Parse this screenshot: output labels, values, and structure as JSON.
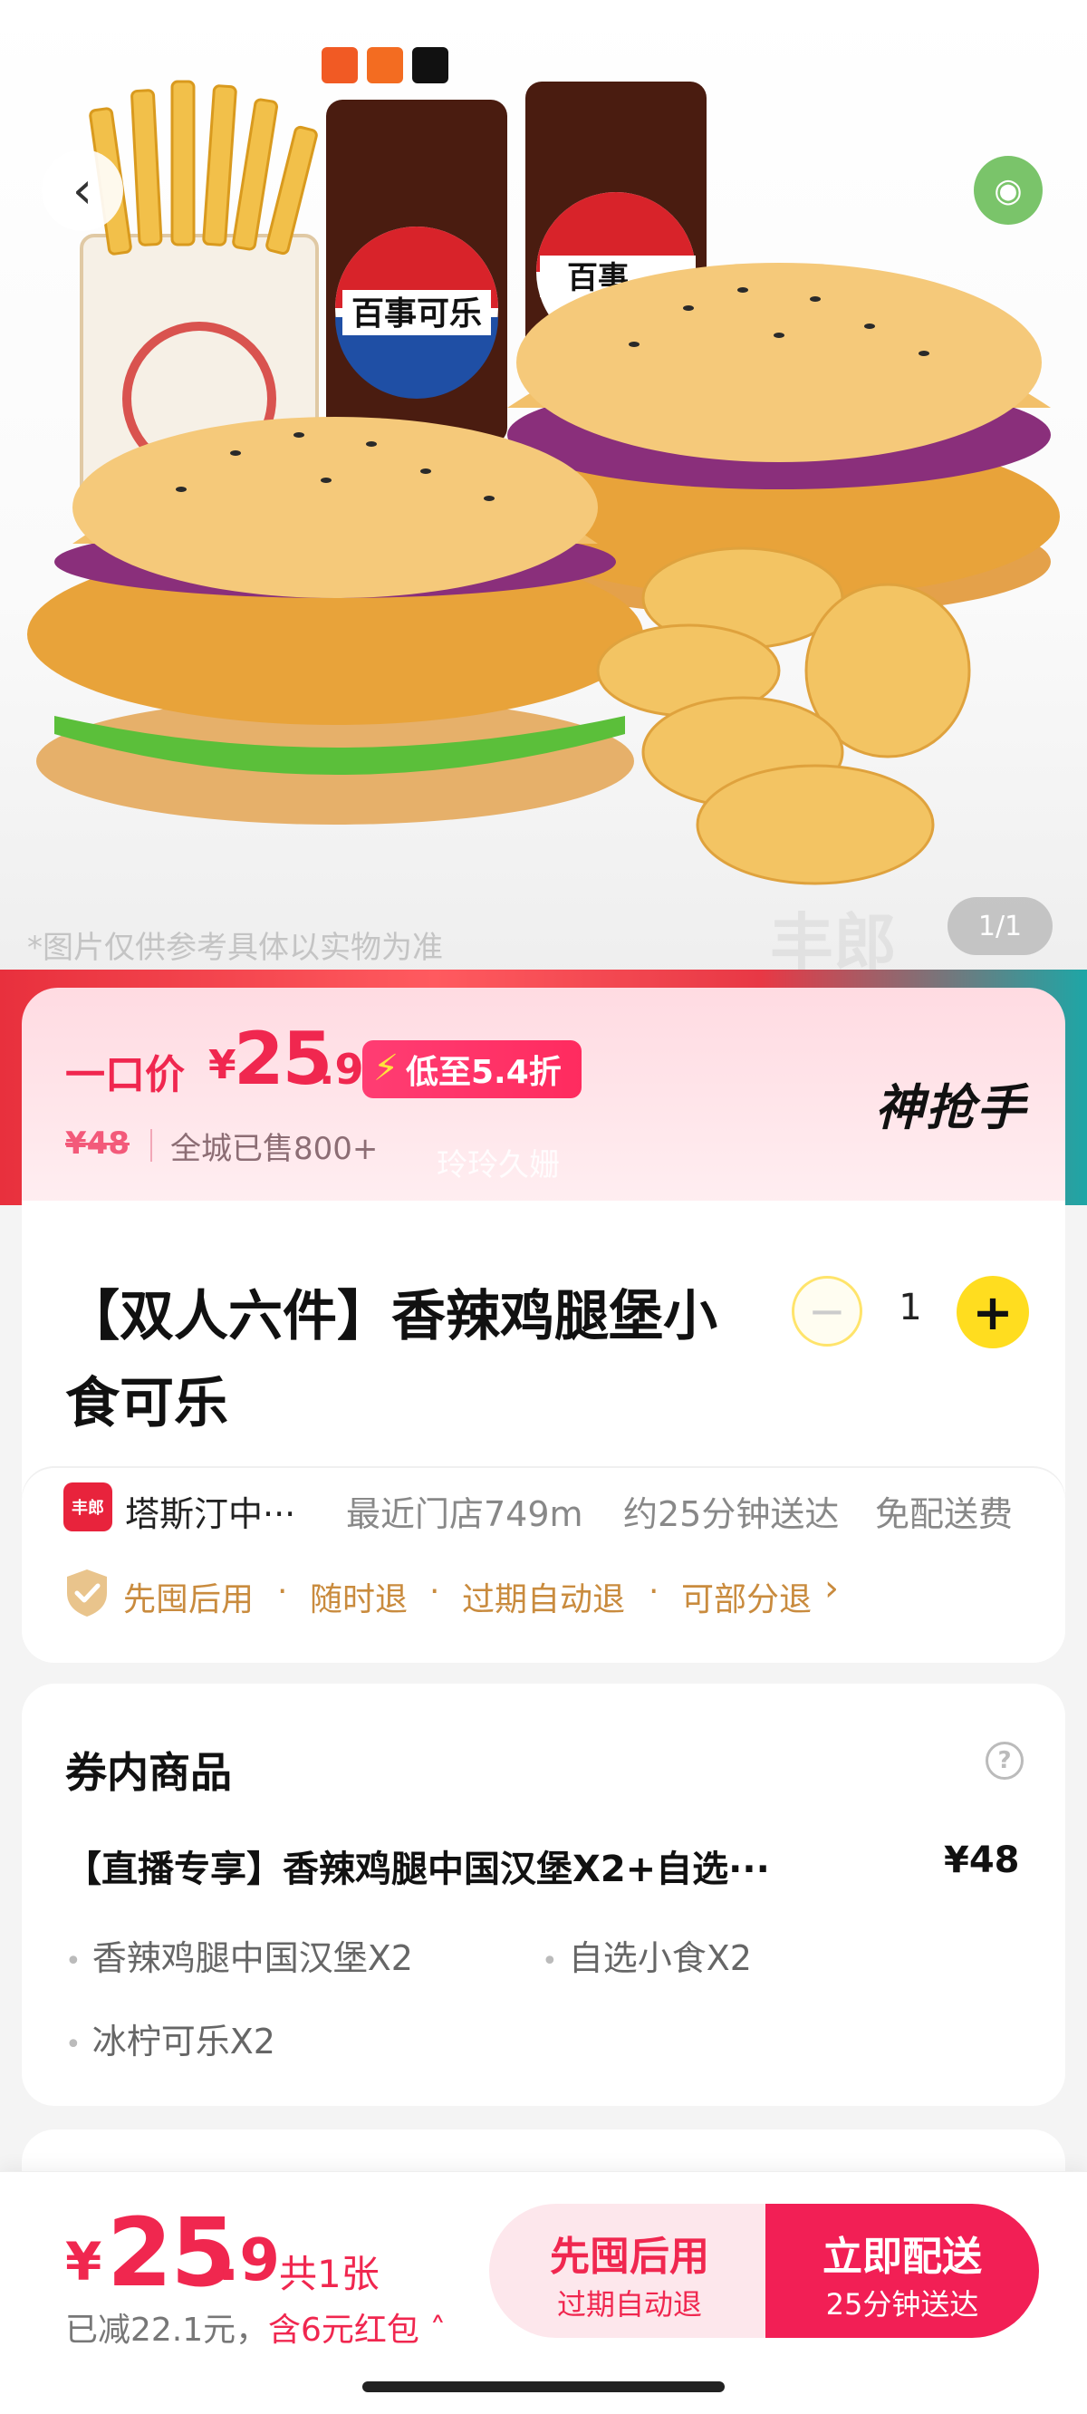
{
  "hero": {
    "disclaimer": "*图片仅供参考具体以实物为准",
    "image_counter": "1/1",
    "watermark": "丰郎"
  },
  "price": {
    "label": "一口价",
    "currency": "¥",
    "integer": "25",
    "decimal": ".9",
    "discount_badge": "低至5.4折",
    "original_price": "¥48",
    "sold": "全城已售800+",
    "brand_logo": "神抢手",
    "anchor_text": "玲玲久姗"
  },
  "product": {
    "title": "【双人六件】香辣鸡腿堡小食可乐",
    "quantity": "1"
  },
  "store": {
    "logo_text": "丰郎",
    "name": "塔斯汀中···",
    "distance": "最近门店749m",
    "eta": "约25分钟送达",
    "fee": "免配送费",
    "services": [
      "先囤后用",
      "随时退",
      "过期自动退",
      "可部分退"
    ],
    "chevron": "›"
  },
  "coupon_items": {
    "title": "券内商品",
    "help": "?",
    "item_name": "【直播专享】香辣鸡腿中国汉堡X2+自选···",
    "item_price": "¥48",
    "sub_items": [
      "香辣鸡腿中国汉堡X2",
      "自选小食X2",
      "冰柠可乐X2"
    ]
  },
  "bottom": {
    "currency": "¥",
    "integer": "25",
    "decimal": ".9",
    "count": "共1张",
    "saved": "已减22.1元，",
    "red_packet": "含6元红包 ˄",
    "btn_left_title": "先囤后用",
    "btn_left_sub": "过期自动退",
    "btn_right_title": "立即配送",
    "btn_right_sub": "25分钟送达"
  },
  "colors": {
    "accent": "#f0274f",
    "button_primary": "#f21f55",
    "plus_button": "#ffdd1f",
    "service_text": "#c98b3e"
  }
}
